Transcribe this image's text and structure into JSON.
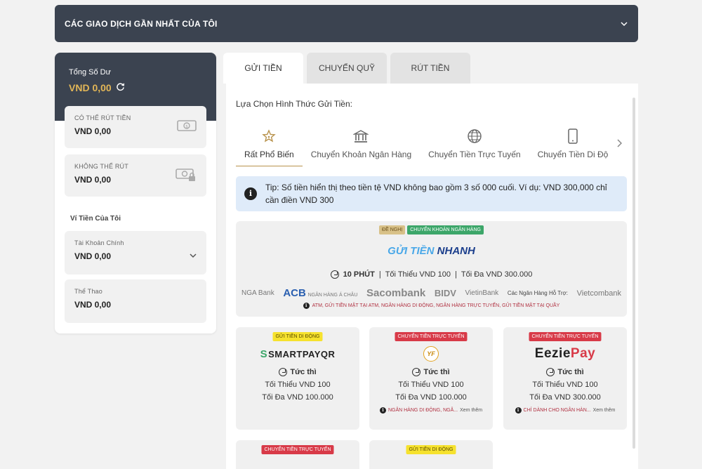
{
  "topbar": {
    "title": "CÁC GIAO DỊCH GẦN NHẤT CỦA TÔI"
  },
  "balance": {
    "label": "Tổng Số Dư",
    "value": "VND  0,00",
    "withdrawable": {
      "label": "CÓ THỂ RÚT TIỀN",
      "value": "VND  0,00"
    },
    "non_withdrawable": {
      "label": "KHÔNG THỂ RÚT",
      "value": "VND  0,00"
    }
  },
  "wallets": {
    "title": "Ví Tiền Của Tôi",
    "main": {
      "label": "Tài Khoản Chính",
      "value": "VND  0,00"
    },
    "sports": {
      "label": "Thể Thao",
      "value": "VND  0,00"
    }
  },
  "tabs": [
    {
      "label": "GỬI TIỀN",
      "active": true
    },
    {
      "label": "CHUYỂN QUỸ",
      "active": false
    },
    {
      "label": "RÚT TIỀN",
      "active": false
    }
  ],
  "deposit": {
    "section_title": "Lựa Chọn Hình Thức Gửi Tiền:",
    "methods": [
      {
        "label": "Rất Phổ Biến",
        "icon": "star-icon"
      },
      {
        "label": "Chuyển Khoản Ngân Hàng",
        "icon": "bank-icon"
      },
      {
        "label": "Chuyển Tiền Trực Tuyến",
        "icon": "globe-icon"
      },
      {
        "label": "Chuyển Tiền Di Độ",
        "icon": "phone-icon"
      }
    ],
    "tip": "Tip: Số tiền hiển thị theo tiền tệ VND không bao gồm 3 số 000 cuối. Ví dụ: VND 300,000 chỉ cần điền VND 300",
    "promo": {
      "badge_recommend": "ĐỀ NGHỊ",
      "badge_type": "CHUYỂN KHOẢN NGÂN HÀNG",
      "logo_a": "GỬI TIỀN",
      "logo_b": "NHANH",
      "time": "10 PHÚT",
      "min": "Tối Thiểu VND 100",
      "max": "Tối Đa VND 300.000",
      "sep": "|",
      "banks": [
        "NGA Bank",
        "ACB",
        "NGÂN HÀNG Á CHÂU",
        "Sacombank",
        "BIDV",
        "VietinBank",
        "Các Ngân Hàng Hỗ Trợ:",
        "Vietcombank"
      ],
      "note": "ATM, GỬI TIỀN MẶT TẠI ATM, NGÂN HÀNG DI ĐỘNG, NGÂN HÀNG TRỰC TUYẾN, GỬI TIỀN MẶT TẠI QUẦY"
    },
    "providers": [
      {
        "badge": "GỬI TIỀN DI ĐỘNG",
        "logo": "SMARTPAYQR",
        "time": "Tức thì",
        "min": "Tối Thiểu VND 100",
        "max": "Tối Đa VND 100.000",
        "note": "",
        "more": ""
      },
      {
        "badge": "CHUYỂN TIỀN TRỰC TUYẾN",
        "logo": "YF",
        "time": "Tức thì",
        "min": "Tối Thiểu VND 100",
        "max": "Tối Đa VND 100.000",
        "note": "NGÂN HÀNG DI ĐỘNG, NGÂ...",
        "more": "Xem thêm"
      },
      {
        "badge": "CHUYỂN TIỀN TRỰC TUYẾN",
        "logo_a": "Eezie",
        "logo_b": "Pay",
        "time": "Tức thì",
        "min": "Tối Thiểu VND 100",
        "max": "Tối Đa VND 300.000",
        "note": "CHỈ DÀNH CHO NGÂN HÀN...",
        "more": "Xem thêm"
      },
      {
        "badge": "CHUYỂN TIỀN TRỰC TUYẾN"
      },
      {
        "badge": "GỬI TIỀN DI ĐỘNG"
      }
    ]
  },
  "colors": {
    "header": "#3b4350",
    "gold": "#e2b657",
    "tip_bg": "#dfebf9",
    "red": "#d83a48",
    "green": "#3ca669",
    "yellow": "#f6e22e"
  }
}
